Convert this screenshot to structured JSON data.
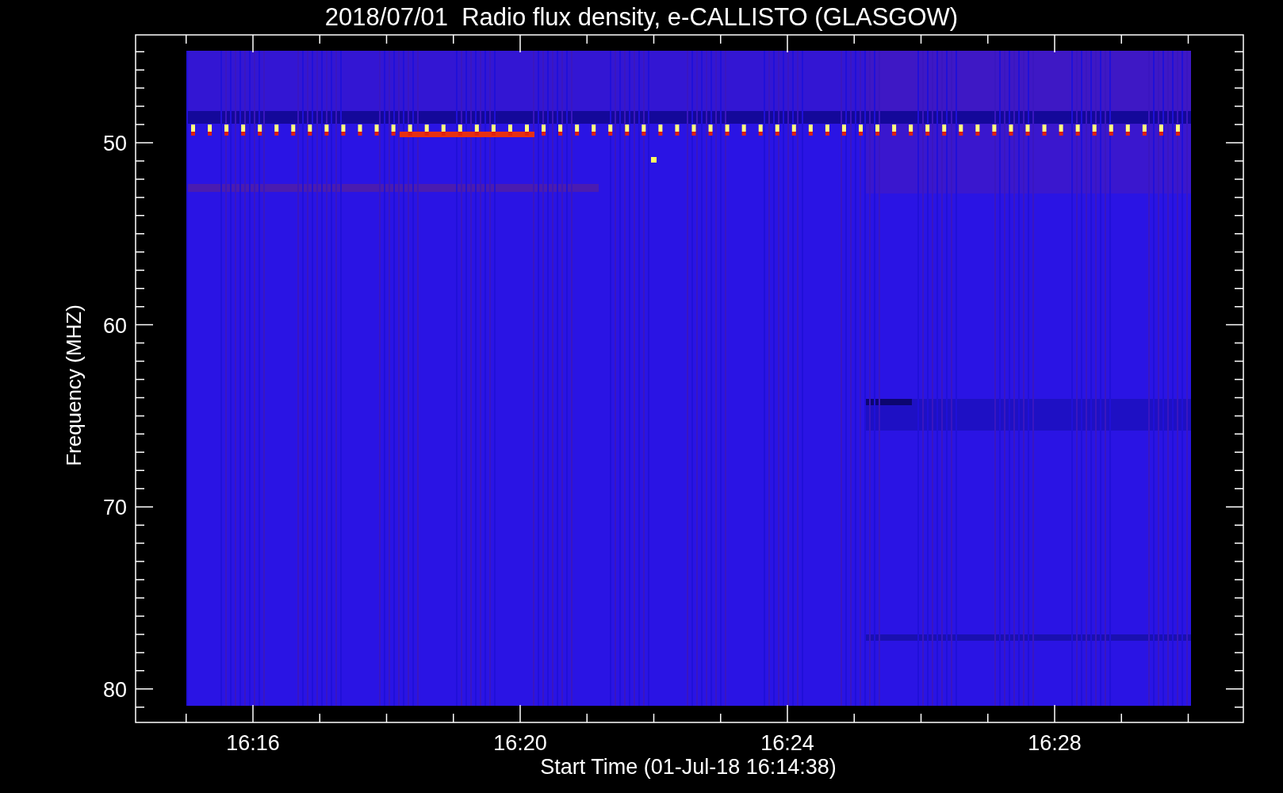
{
  "plot": {
    "title": "2018/07/01  Radio flux density, e-CALLISTO (GLASGOW)",
    "y_axis_label": "Frequency (MHZ)",
    "y_tick_labels": [
      "50",
      "60",
      "70",
      "80"
    ],
    "x_axis_label": "Start Time (01-Jul-18 16:14:38)",
    "x_tick_labels": [
      "16:16",
      "16:20",
      "16:24",
      "16:28"
    ]
  }
}
